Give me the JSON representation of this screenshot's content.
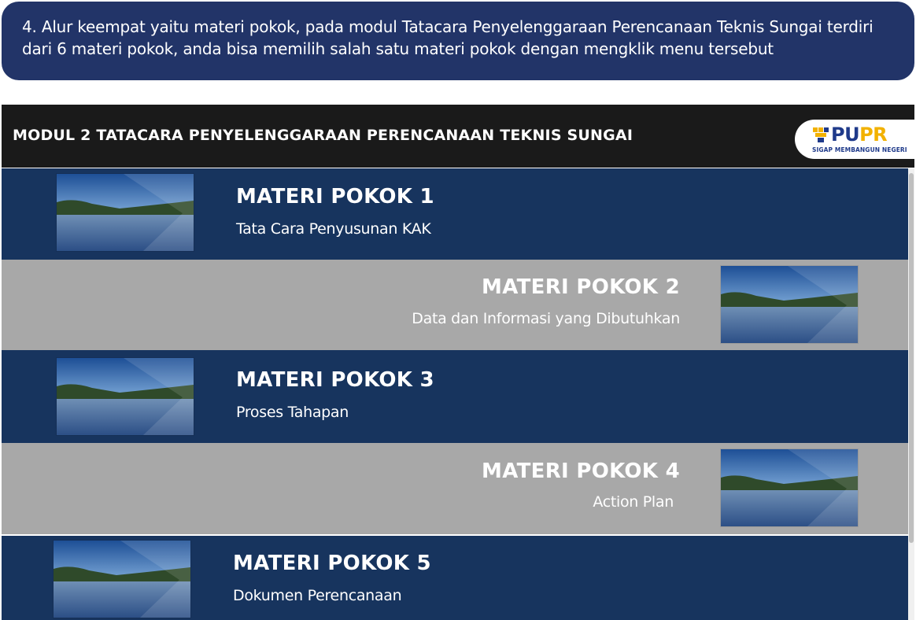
{
  "instruction": {
    "text": "4. Alur keempat yaitu materi pokok, pada modul Tatacara Penyelenggaraan Perencanaan Teknis Sungai terdiri dari 6 materi pokok, anda bisa memilih salah satu materi pokok dengan mengklik menu tersebut"
  },
  "header": {
    "title": "MODUL 2 TATACARA PENYELENGGARAAN PERENCANAAN TEKNIS SUNGAI",
    "logo": {
      "word_main": "PU",
      "word_accent": "PR",
      "tagline": "SIGAP MEMBANGUN NEGERI",
      "icon": "pupr-emblem-icon"
    }
  },
  "colors": {
    "banner": "#223468",
    "header": "#1a1a1a",
    "row_dark": "#17345e",
    "row_light": "#a8a8a8",
    "logo_blue": "#1f3a8a",
    "logo_gold": "#f2b100"
  },
  "materi": [
    {
      "title": "MATERI POKOK 1",
      "subtitle": "Tata Cara Penyusunan KAK",
      "thumbnail": "river-landscape-image"
    },
    {
      "title": "MATERI POKOK 2",
      "subtitle": "Data dan Informasi yang Dibutuhkan",
      "thumbnail": "river-landscape-image"
    },
    {
      "title": "MATERI POKOK 3",
      "subtitle": "Proses Tahapan",
      "thumbnail": "river-landscape-image"
    },
    {
      "title": "MATERI POKOK 4",
      "subtitle": "Action Plan",
      "thumbnail": "river-landscape-image"
    },
    {
      "title": "MATERI POKOK 5",
      "subtitle": "Dokumen Perencanaan",
      "thumbnail": "river-landscape-image"
    }
  ]
}
